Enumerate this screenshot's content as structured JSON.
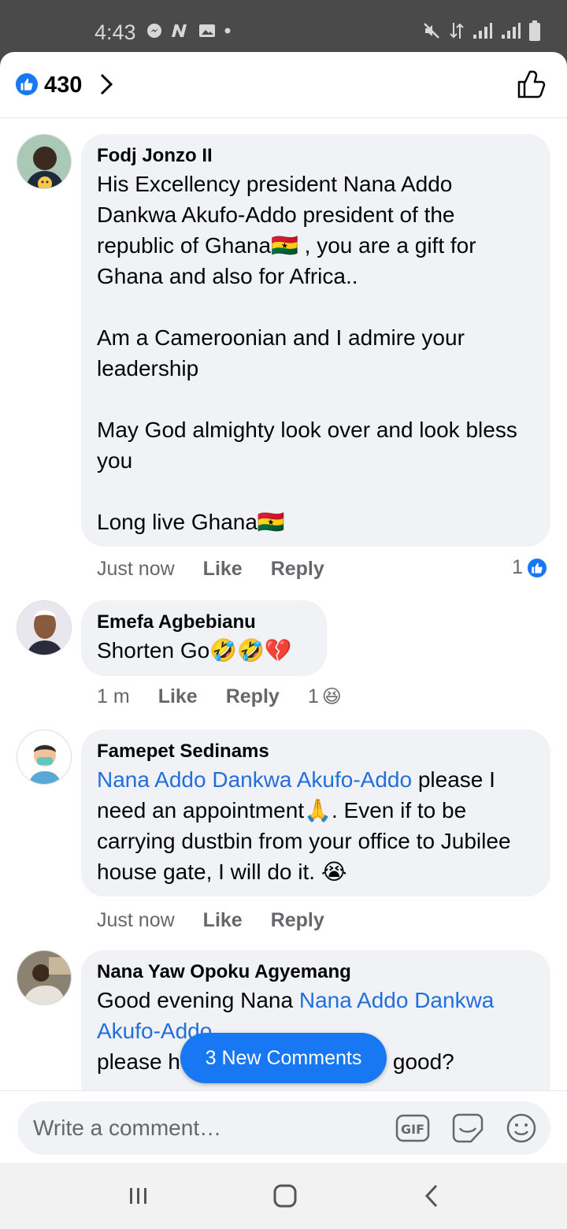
{
  "status_bar": {
    "time": "4:43",
    "left_icons": [
      "messenger-icon",
      "n-icon",
      "gallery-icon",
      "dot-icon"
    ],
    "right_icons": [
      "mute-icon",
      "data-arrows-icon",
      "signal-icon",
      "signal-icon",
      "battery-icon"
    ]
  },
  "header": {
    "reaction_icon": "thumbs-up-badge-icon",
    "reaction_count": "430",
    "right_icon": "thumbs-up-outline-icon"
  },
  "comments": [
    {
      "author": "Fodj Jonzo II",
      "text": "His Excellency president Nana Addo Dankwa Akufo-Addo president of the republic of Ghana🇬🇭 , you are a gift for Ghana and also for Africa..\n\nAm a Cameroonian and I admire your leadership\n\nMay God almighty look over and look bless you\n\nLong live Ghana🇬🇭",
      "time": "Just now",
      "like_label": "Like",
      "reply_label": "Reply",
      "reaction_count": "1",
      "reaction_icon": "like-reaction-icon"
    },
    {
      "author": "Emefa Agbebianu",
      "text": "Shorten Go🤣🤣💔",
      "time": "1 m",
      "like_label": "Like",
      "reply_label": "Reply",
      "reaction_count": "1",
      "reaction_icon": "haha-reaction-icon"
    },
    {
      "author": "Famepet Sedinams",
      "mention": "Nana Addo Dankwa Akufo-Addo",
      "text": " please I need an appointment🙏. Even if to be carrying dustbin from your office to Jubilee house gate, I will do it. 😭",
      "time": "Just now",
      "like_label": "Like",
      "reply_label": "Reply"
    },
    {
      "author": "Nana Yaw Opoku Agyemang",
      "text_before": "Good evening Nana ",
      "mention": "Nana Addo Dankwa Akufo-Addo",
      "text_after": "please h",
      "text_tail": "good?"
    }
  ],
  "new_comments_button": "3 New Comments",
  "composer": {
    "placeholder": "Write a comment…",
    "icons": [
      "gif-icon",
      "sticker-icon",
      "emoji-icon"
    ]
  },
  "nav": {
    "icons": [
      "recent-apps-icon",
      "home-icon",
      "back-icon"
    ]
  }
}
